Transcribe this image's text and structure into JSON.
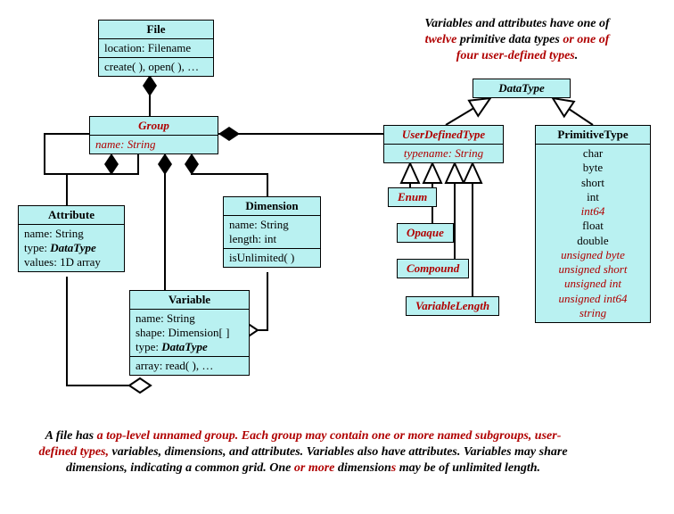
{
  "topCaption": {
    "l1a": "Variables and attributes have one of",
    "l2a": "twelve",
    "l2b": " primitive data types ",
    "l2c": "or one of",
    "l3a": "four user-defined types",
    "l3b": "."
  },
  "file": {
    "title": "File",
    "loc": "location: Filename",
    "ops": "create( ), open( ), …"
  },
  "group": {
    "title": "Group",
    "attr": "name: String"
  },
  "attribute": {
    "title": "Attribute",
    "r1": "name: String",
    "r2a": "type: ",
    "r2b": "DataType",
    "r3": "values: 1D array"
  },
  "dimension": {
    "title": "Dimension",
    "r1": "name: String",
    "r2": "length: int",
    "r3": "isUnlimited( )"
  },
  "variable": {
    "title": "Variable",
    "r1": "name: String",
    "r2": "shape: Dimension[ ]",
    "r3a": "type:   ",
    "r3b": "DataType",
    "r4": "array: read( ), …"
  },
  "datatype": {
    "title": "DataType"
  },
  "udt": {
    "title": "UserDefinedType",
    "attr": "typename: String"
  },
  "udtKinds": {
    "enum": "Enum",
    "opaque": "Opaque",
    "compound": "Compound",
    "varlen": "VariableLength"
  },
  "primitive": {
    "title": "PrimitiveType",
    "items": [
      "char",
      "byte",
      "short",
      "int",
      "int64",
      "float",
      "double",
      "unsigned byte",
      "unsigned short",
      "unsigned int",
      "unsigned int64",
      "string"
    ],
    "redIdx": [
      4,
      7,
      8,
      9,
      10,
      11
    ]
  },
  "bottomCaption": {
    "p1": "A file has ",
    "p2": "a top-level unnamed group.  Each group may contain one or more named subgroups, user-defined types,",
    "p3": " variables, dimensions, and attributes. Variables also have attributes.  Variables may share dimensions, indicating a common grid.  One ",
    "p4": "or more",
    "p5": " dimension",
    "p6": "s",
    "p7": " may be of unlimited length."
  }
}
